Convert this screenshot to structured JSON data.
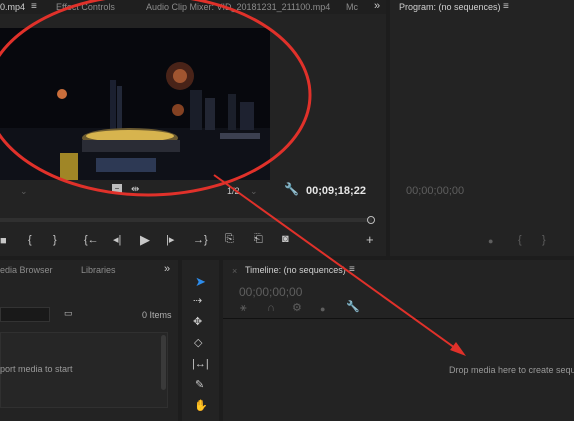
{
  "source_panel": {
    "tabs": [
      "0.mp4",
      "Effect Controls",
      "Audio Clip Mixer: VID_20181231_211100.mp4",
      "Mc"
    ],
    "timecode": "00;09;18;22",
    "resolution": "1/2"
  },
  "program_panel": {
    "title": "Program: (no sequences)",
    "timecode": "00;00;00;00"
  },
  "project_panel": {
    "tabs": [
      "edia Browser",
      "Libraries"
    ],
    "item_count": "0 Items",
    "hint": "port media to start"
  },
  "timeline_panel": {
    "title": "Timeline: (no sequences)",
    "timecode": "00;00;00;00",
    "drop_hint": "Drop media here to create seque"
  },
  "annotation": {
    "color": "#e0312a"
  }
}
